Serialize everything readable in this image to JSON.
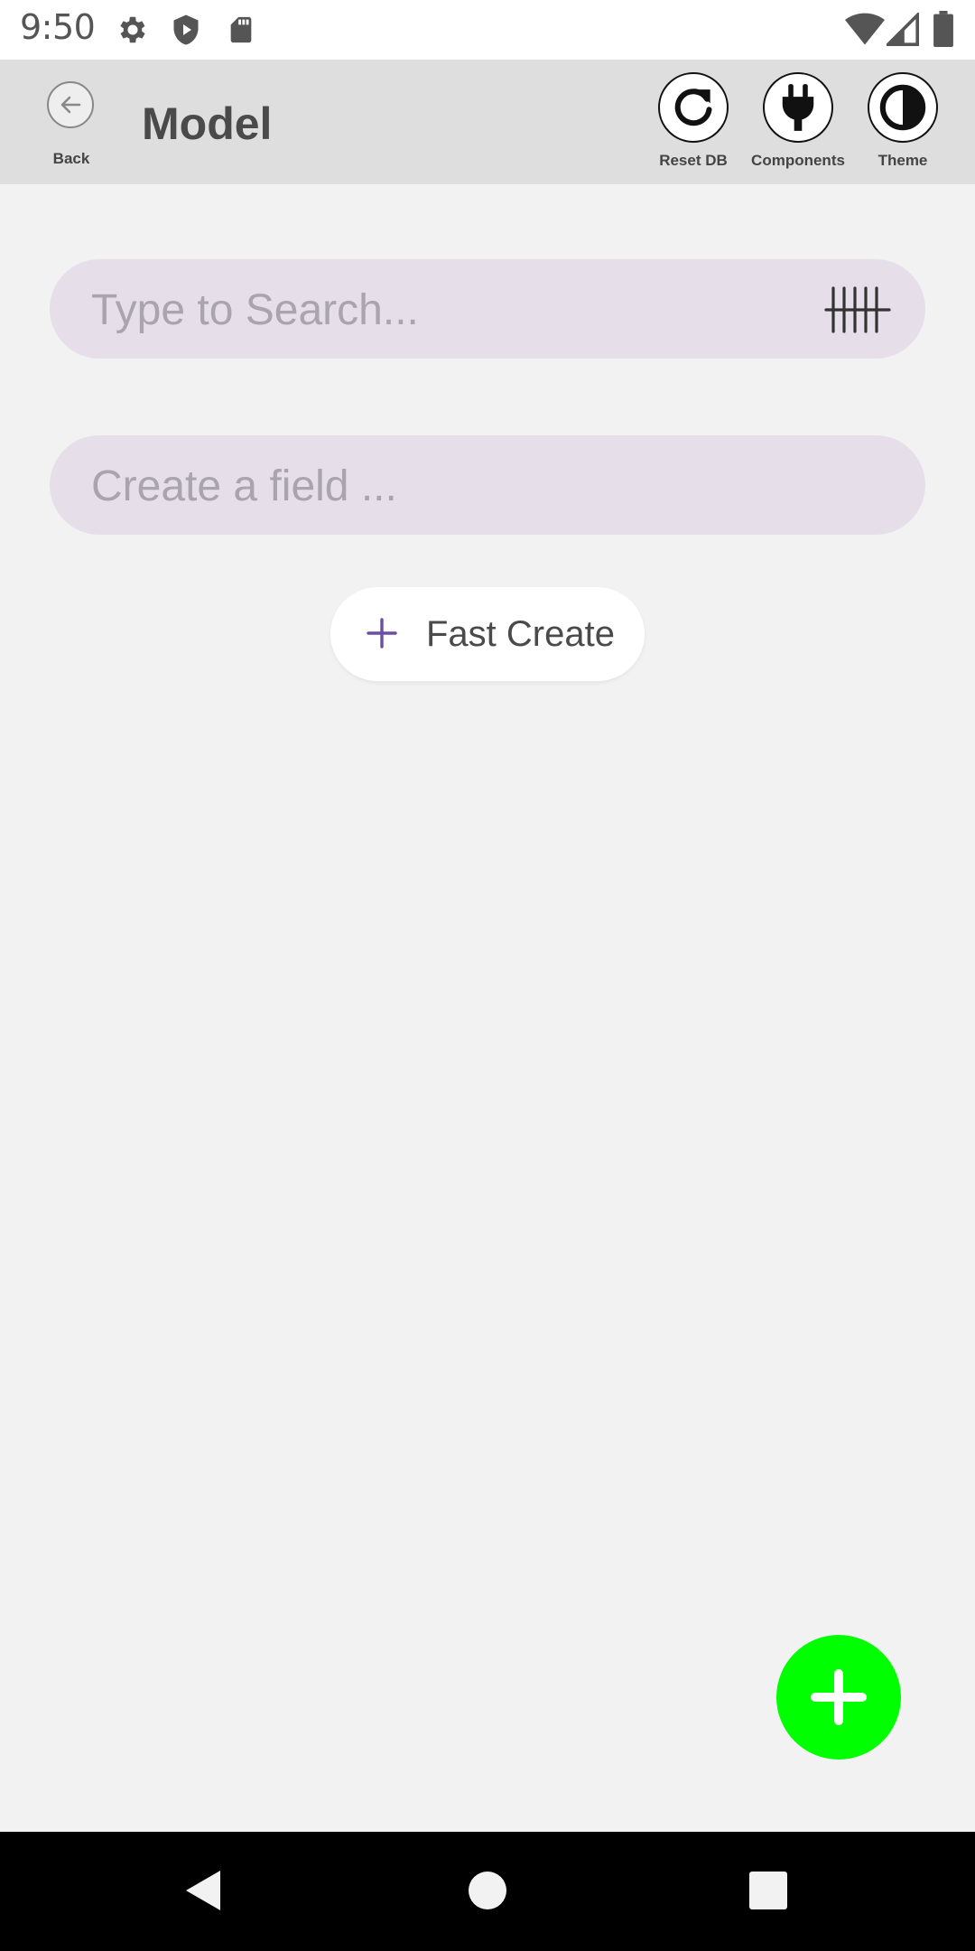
{
  "status_bar": {
    "time": "9:50",
    "icons": [
      "gear-icon",
      "shield-play-icon",
      "sd-card-icon",
      "wifi-icon",
      "signal-icon",
      "battery-icon"
    ]
  },
  "app_bar": {
    "back_label": "Back",
    "title": "Model",
    "actions": [
      {
        "label": "Reset DB",
        "icon": "refresh-icon"
      },
      {
        "label": "Components",
        "icon": "plug-icon"
      },
      {
        "label": "Theme",
        "icon": "contrast-icon"
      }
    ]
  },
  "search": {
    "placeholder": "Type to Search...",
    "value": "",
    "icon": "tally-icon"
  },
  "create_field": {
    "placeholder": "Create a field ...",
    "value": ""
  },
  "fast_create": {
    "label": "Fast Create",
    "icon": "plus-icon"
  },
  "fab": {
    "icon": "plus-icon"
  },
  "nav_bar": {
    "buttons": [
      "back-triangle-icon",
      "home-circle-icon",
      "recents-square-icon"
    ]
  },
  "colors": {
    "fab": "#00ff00",
    "input_bg": "#e6dfea",
    "accent": "#6a4ea8",
    "app_bar": "#dedede",
    "background": "#f2f2f2"
  }
}
